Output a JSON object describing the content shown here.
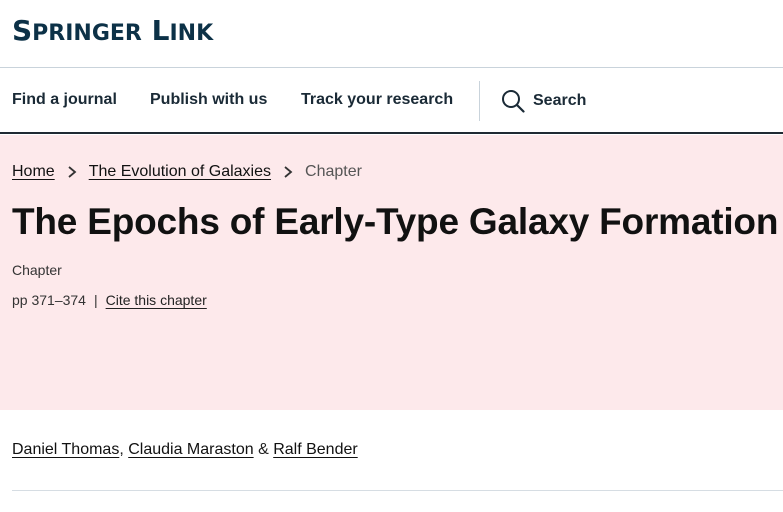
{
  "brand": {
    "logo_part1": "S",
    "logo_part2": "PRINGER",
    "logo_part3": " L",
    "logo_part4": "INK",
    "color": "#0c3147"
  },
  "nav": {
    "items": [
      {
        "label": "Find a journal"
      },
      {
        "label": "Publish with us"
      },
      {
        "label": "Track your research"
      }
    ],
    "search_label": "Search",
    "search_icon": "search-icon"
  },
  "breadcrumb": {
    "items": [
      {
        "label": "Home"
      },
      {
        "label": "The Evolution of Galaxies"
      }
    ],
    "current": "Chapter",
    "separator_icon": "chevron-right-icon"
  },
  "chapter": {
    "title": "The Epochs of Early-Type Galaxy Formation",
    "type": "Chapter",
    "pages": "pp 371–374",
    "separator": "|",
    "cite_label": "Cite this chapter"
  },
  "authors": {
    "list": [
      {
        "name": "Daniel Thomas"
      },
      {
        "name": "Claudia Maraston"
      },
      {
        "name": "Ralf Bender"
      }
    ],
    "comma": ",",
    "ampersand": "&"
  },
  "colors": {
    "hero_background": "#fde9eb",
    "nav_border": "#1f2a33"
  }
}
